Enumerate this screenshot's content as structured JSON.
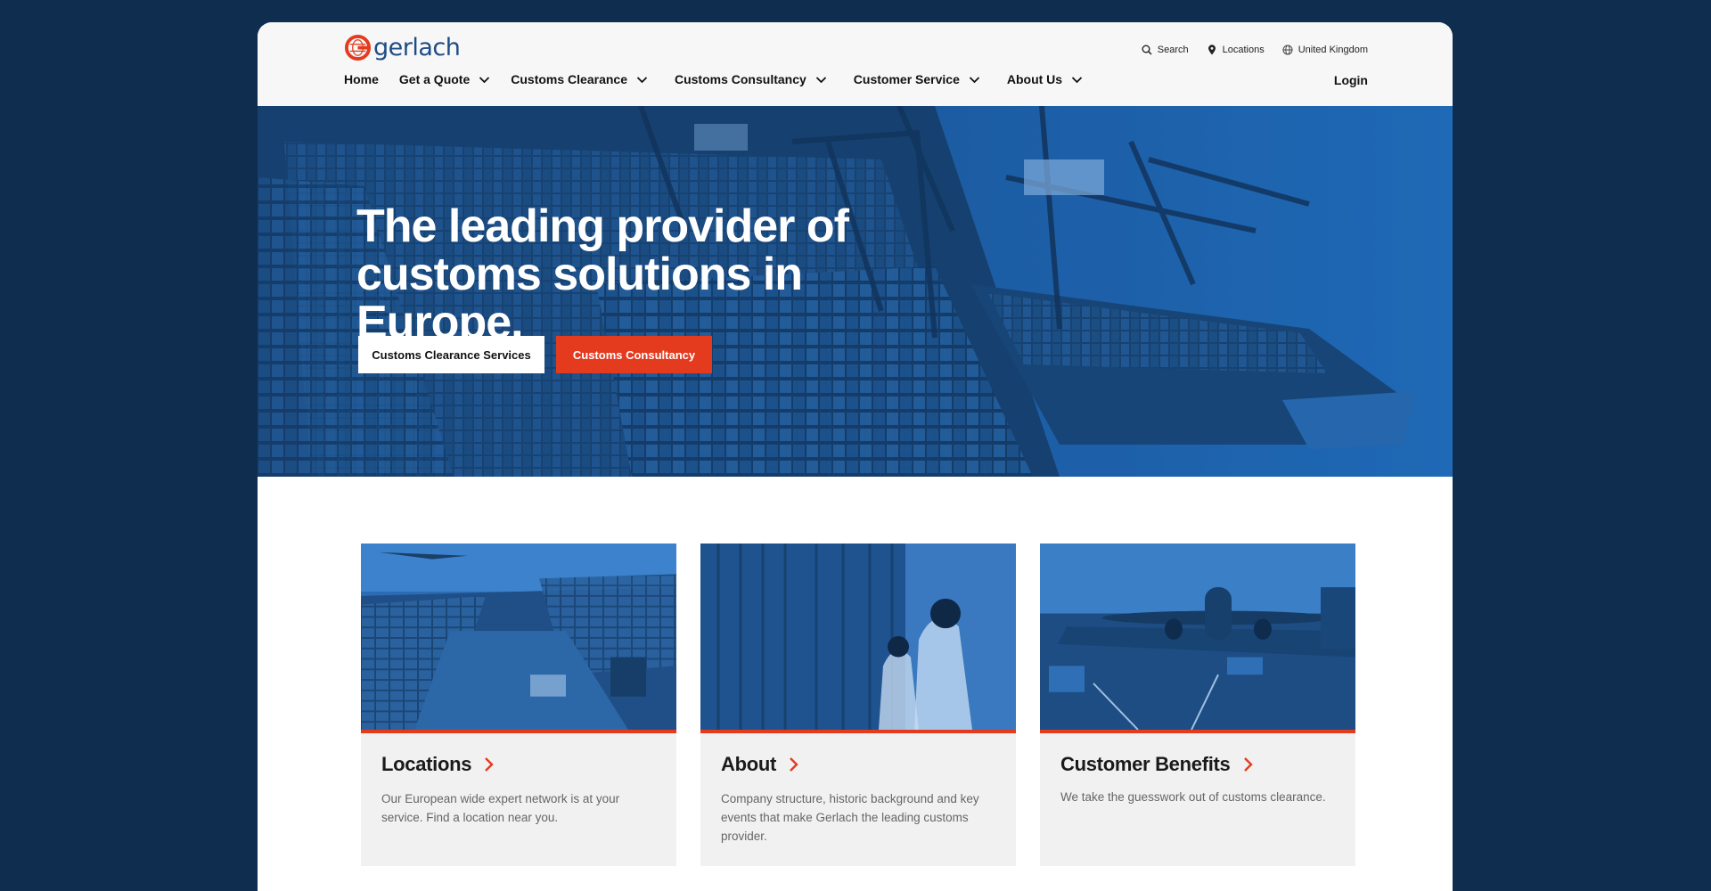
{
  "brand": {
    "name": "gerlach",
    "logo_icon": "gerlach-globe-logo",
    "accent": "#e43b1f",
    "brand_blue": "#1e4c86"
  },
  "utility_nav": [
    {
      "label": "Search",
      "icon": "search-icon"
    },
    {
      "label": "Locations",
      "icon": "map-pin-icon"
    },
    {
      "label": "United Kingdom",
      "icon": "globe-icon"
    }
  ],
  "main_nav": [
    {
      "label": "Home",
      "dropdown": false
    },
    {
      "label": "Get a Quote",
      "dropdown": true
    },
    {
      "label": "Customs Clearance",
      "dropdown": true
    },
    {
      "label": "Customs Consultancy",
      "dropdown": true
    },
    {
      "label": "Customer Service",
      "dropdown": true
    },
    {
      "label": "About Us",
      "dropdown": true
    }
  ],
  "login_label": "Login",
  "hero": {
    "title": "The leading provider of\ncustoms solutions in Europe.",
    "primary_button": "Customs Clearance Services",
    "secondary_button": "Customs Consultancy"
  },
  "cards": [
    {
      "title": "Locations",
      "description": "Our European wide expert network is at your service. Find a location near you."
    },
    {
      "title": "About",
      "description": "Company structure, historic background and key events that make Gerlach the leading customs provider."
    },
    {
      "title": "Customer Benefits",
      "description": "We take the guesswork out of customs clearance."
    }
  ]
}
